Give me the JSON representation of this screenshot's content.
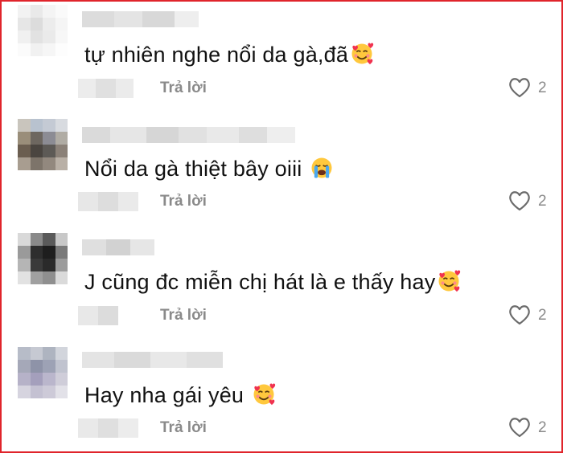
{
  "comments": [
    {
      "text": "tự nhiên nghe nổi da gà,đã",
      "emoji": "smiling-face-with-hearts",
      "reply_label": "Trả lời",
      "like_count": "2"
    },
    {
      "text": "Nổi da gà thiệt bây oiii",
      "emoji": "loudly-crying-face",
      "reply_label": "Trả lời",
      "like_count": "2"
    },
    {
      "text": "J cũng đc miễn chị hát là e thấy hay",
      "emoji": "smiling-face-with-hearts",
      "reply_label": "Trả lời",
      "like_count": "2"
    },
    {
      "text": "Hay nha gái yêu",
      "emoji": "smiling-face-with-hearts",
      "reply_label": "Trả lời",
      "like_count": "2"
    }
  ],
  "colors": {
    "border": "#e0242b",
    "meta_text": "#8a8a8a",
    "comment_text": "#111111"
  }
}
